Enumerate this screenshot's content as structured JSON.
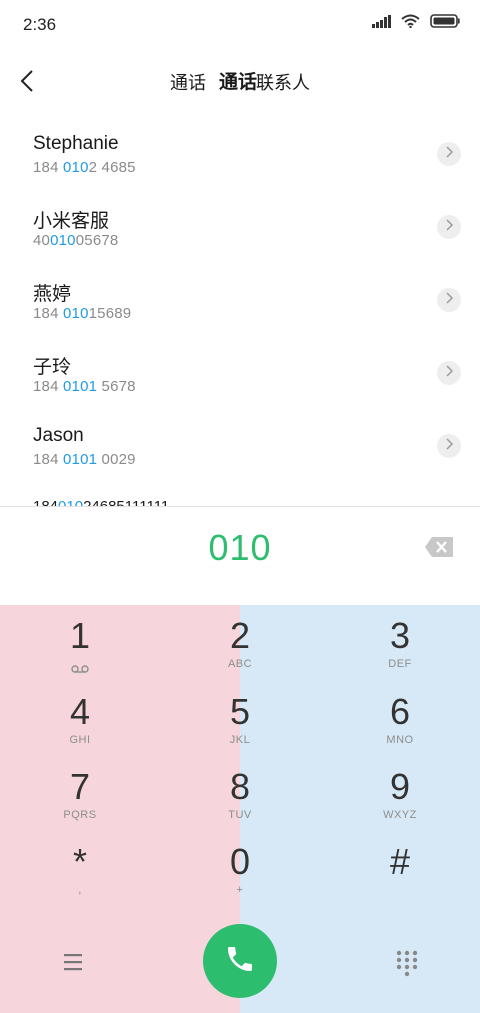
{
  "status_bar": {
    "time": "2:36"
  },
  "header": {
    "tabs": [
      {
        "label": "通话"
      },
      {
        "label": "通话"
      },
      {
        "label": "联系人"
      }
    ]
  },
  "contacts": [
    {
      "name": "Stephanie",
      "number_pre": "184 ",
      "number_match": "010",
      "number_post": "2 4685"
    },
    {
      "name": "小米客服",
      "number_pre": "40",
      "number_match": "010",
      "number_post": "05678"
    },
    {
      "name": "燕婷",
      "number_pre": "184 ",
      "number_match": "010",
      "number_post": "15689"
    },
    {
      "name": "子玲",
      "number_pre": "184 ",
      "number_match": "0101",
      "number_post": " 5678"
    },
    {
      "name": "Jason",
      "number_pre": "184 ",
      "number_match": "0101",
      "number_post": " 0029"
    }
  ],
  "partial_contact": {
    "number_pre": "184",
    "number_match": "010",
    "number_post": "24685111111"
  },
  "dialer": {
    "input": "010"
  },
  "keypad": {
    "keys": [
      {
        "digit": "1",
        "letters": ""
      },
      {
        "digit": "2",
        "letters": "ABC"
      },
      {
        "digit": "3",
        "letters": "DEF"
      },
      {
        "digit": "4",
        "letters": "GHI"
      },
      {
        "digit": "5",
        "letters": "JKL"
      },
      {
        "digit": "6",
        "letters": "MNO"
      },
      {
        "digit": "7",
        "letters": "PQRS"
      },
      {
        "digit": "8",
        "letters": "TUV"
      },
      {
        "digit": "9",
        "letters": "WXYZ"
      },
      {
        "digit": "*",
        "letters": ","
      },
      {
        "digit": "0",
        "letters": "+"
      },
      {
        "digit": "#",
        "letters": ""
      }
    ]
  },
  "icons": {
    "back": "back-arrow-icon",
    "detail": "chevron-right-icon",
    "backspace": "backspace-icon",
    "voicemail": "voicemail-icon",
    "menu": "menu-icon",
    "call": "phone-icon",
    "dialpad": "dialpad-grid-icon"
  },
  "colors": {
    "accent_green": "#2dbd6e",
    "match_blue": "#1e9be6",
    "keypad_left": "#f6d6dc",
    "keypad_right": "#d7e9f6"
  }
}
